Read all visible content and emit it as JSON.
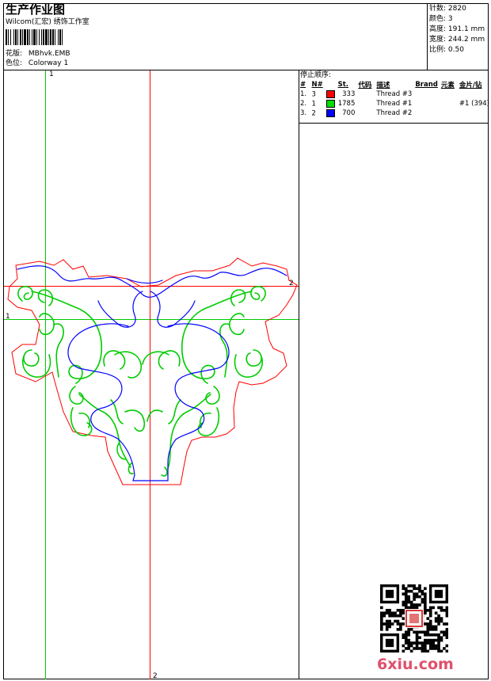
{
  "header": {
    "title": "生产作业图",
    "company": "Wilcom(汇宏) 绣饰工作室",
    "design_label": "花版:",
    "design_value": "MBhvk.EMB",
    "colorway_label": "色位:",
    "colorway_value": "Colorway 1"
  },
  "stats": [
    {
      "label": "针数:",
      "value": "2820"
    },
    {
      "label": "颜色:",
      "value": "3"
    },
    {
      "label": "高度:",
      "value": "191.1 mm"
    },
    {
      "label": "宽度:",
      "value": "244.2 mm"
    },
    {
      "label": "比例:",
      "value": "0.50"
    }
  ],
  "stop_sequence": {
    "title": "停止顺序:",
    "headers": [
      "#",
      "N#",
      "St.",
      "代码",
      "描述",
      "Brand",
      "元素",
      "金片/钻"
    ],
    "rows": [
      {
        "idx": "1.",
        "n": "3",
        "color": "#ff0000",
        "st": "333",
        "code": "",
        "desc": "Thread #3",
        "brand": "",
        "elem": ""
      },
      {
        "idx": "2.",
        "n": "1",
        "color": "#00dd00",
        "st": "1785",
        "code": "",
        "desc": "Thread #1",
        "brand": "",
        "elem": "#1 (394)"
      },
      {
        "idx": "3.",
        "n": "2",
        "color": "#0000ff",
        "st": "700",
        "code": "",
        "desc": "Thread #2",
        "brand": "",
        "elem": ""
      }
    ]
  },
  "guides": {
    "green_v_label": "1",
    "green_h_label": "1",
    "red_v_label": "2",
    "red_h_label": "2"
  },
  "colors": {
    "outline": "#ff0000",
    "green": "#00cc00",
    "blue": "#0000ff",
    "watermark": "#e0506a"
  },
  "watermark": {
    "text": "6xiu.com"
  }
}
